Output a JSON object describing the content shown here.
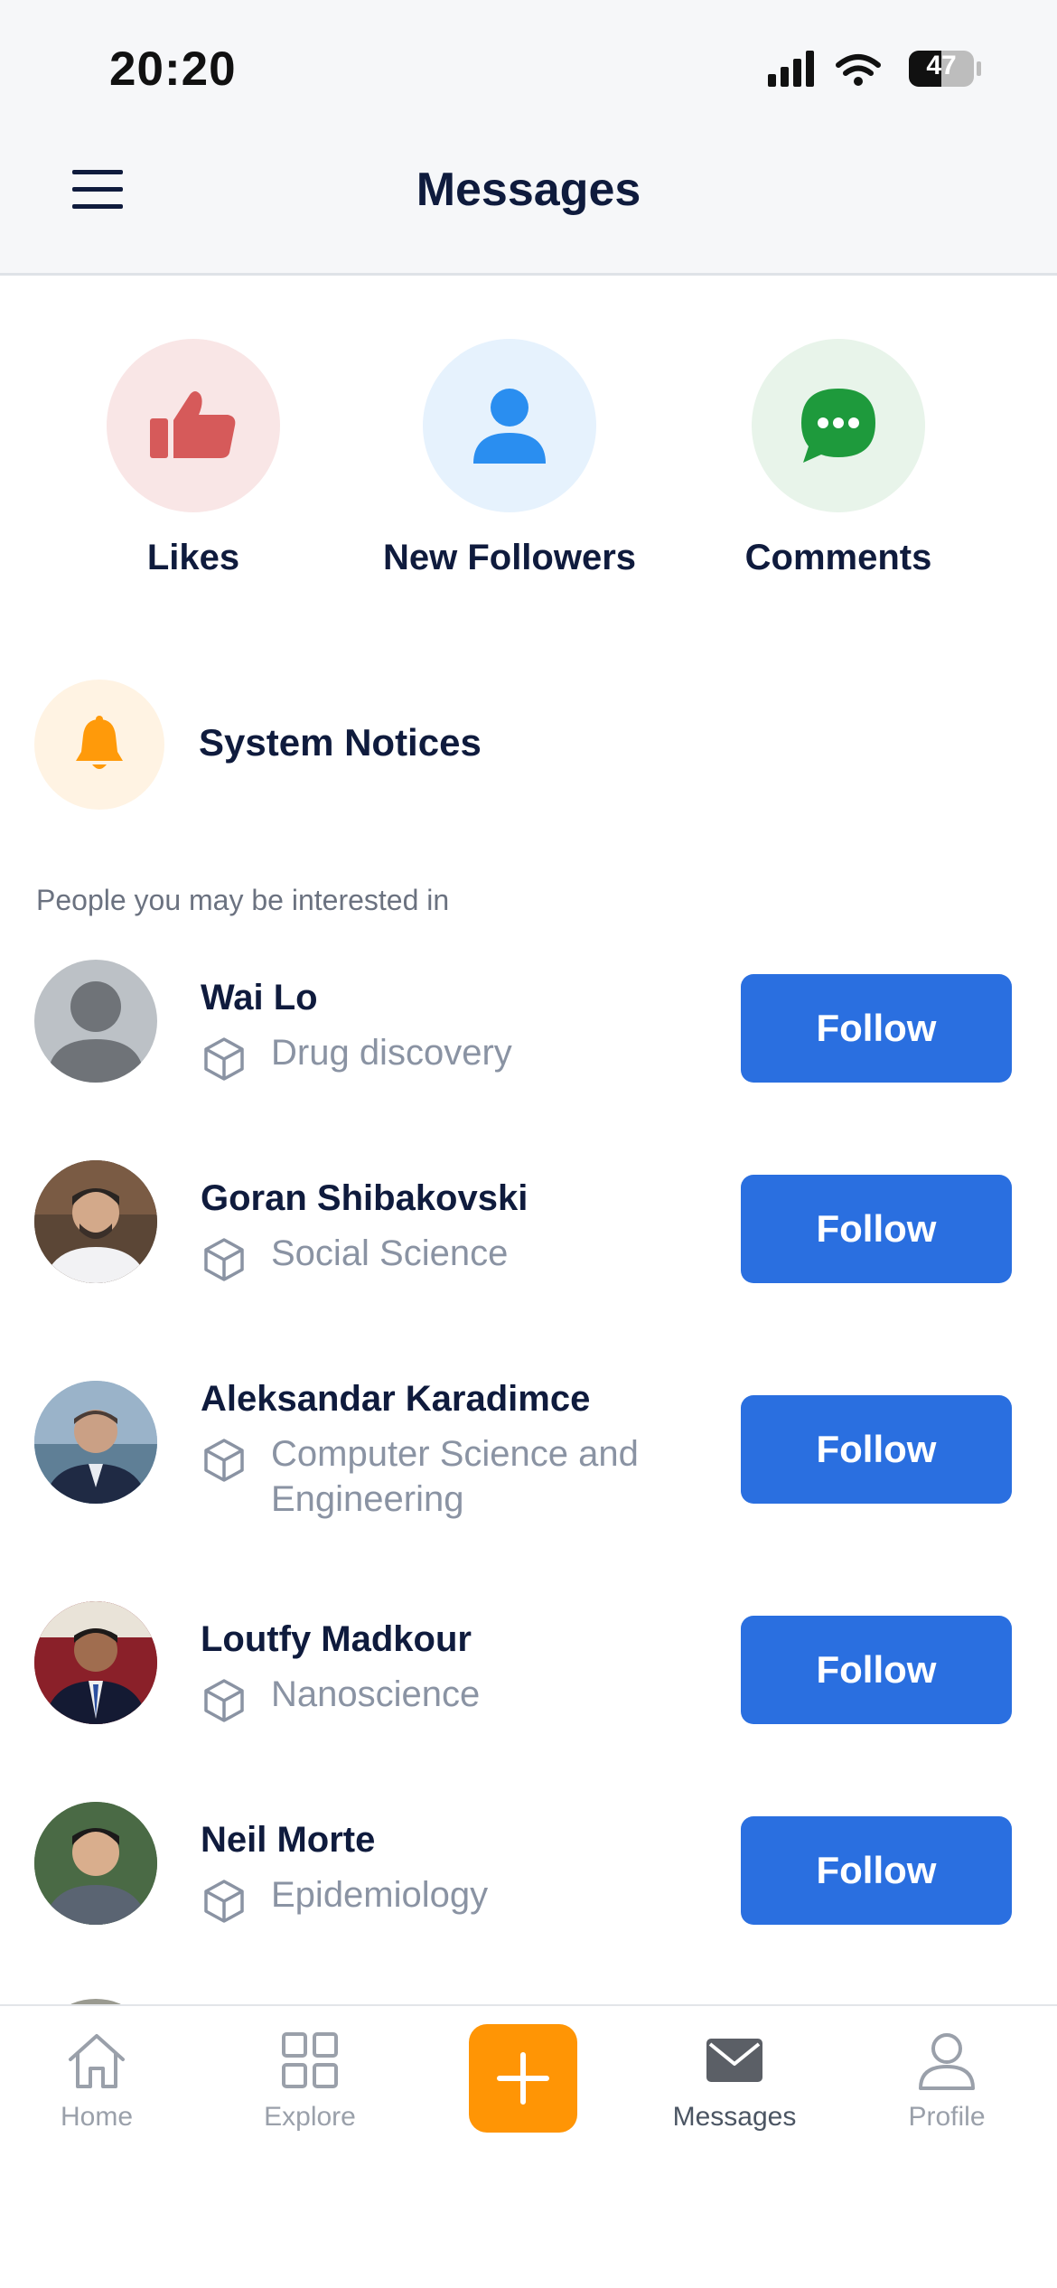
{
  "status_bar": {
    "time": "20:20",
    "battery": "47"
  },
  "header": {
    "title": "Messages",
    "menu_icon": "hamburger-menu-icon"
  },
  "categories": [
    {
      "label": "Likes",
      "icon": "thumbs-up-icon",
      "bg": "#f9e6e6",
      "fg": "#d65a5a"
    },
    {
      "label": "New Followers",
      "icon": "person-icon",
      "bg": "#e6f2fd",
      "fg": "#2a8ef0"
    },
    {
      "label": "Comments",
      "icon": "chat-bubble-icon",
      "bg": "#e8f4ea",
      "fg": "#1e9a3c"
    }
  ],
  "system_notices": {
    "label": "System Notices",
    "icon": "bell-icon",
    "color": "#ff9a0a"
  },
  "suggestions_label": "People you may be interested in",
  "people": [
    {
      "name": "Wai Lo",
      "field": "Drug discovery",
      "follow_label": "Follow"
    },
    {
      "name": "Goran Shibakovski",
      "field": "Social Science",
      "follow_label": "Follow"
    },
    {
      "name": "Aleksandar Karadimce",
      "field_line1": "Computer Science and",
      "field_line2": "Engineering",
      "follow_label": "Follow"
    },
    {
      "name": "Loutfy Madkour",
      "field": "Nanoscience",
      "follow_label": "Follow"
    },
    {
      "name": "Neil Morte",
      "field": "Epidemiology",
      "follow_label": "Follow"
    }
  ],
  "tabs": [
    {
      "label": "Home",
      "icon": "home-icon"
    },
    {
      "label": "Explore",
      "icon": "grid-icon"
    },
    {
      "label": "",
      "icon": "plus-icon"
    },
    {
      "label": "Messages",
      "icon": "envelope-icon"
    },
    {
      "label": "Profile",
      "icon": "person-outline-icon"
    }
  ],
  "colors": {
    "accent": "#2a6fe0",
    "fab": "#ff9505",
    "text": "#0f1b3d",
    "muted": "#8a93a3"
  }
}
